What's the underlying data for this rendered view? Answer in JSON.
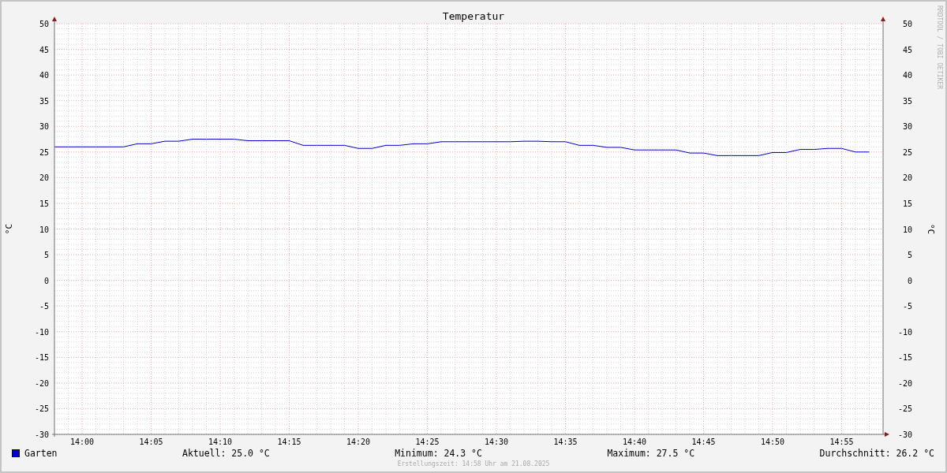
{
  "graph": {
    "watermark": "RRDTOOL / TOBI OETIKER",
    "chart_data": {
      "type": "line",
      "title": "Temperatur",
      "ylabel": "°C",
      "categories": [
        null,
        null,
        "14:00",
        null,
        null,
        null,
        null,
        "14:05",
        null,
        null,
        null,
        null,
        "14:10",
        null,
        null,
        null,
        null,
        "14:15",
        null,
        null,
        null,
        null,
        "14:20",
        null,
        null,
        null,
        null,
        "14:25",
        null,
        null,
        null,
        null,
        "14:30",
        null,
        null,
        null,
        null,
        "14:35",
        null,
        null,
        null,
        null,
        "14:40",
        null,
        null,
        null,
        null,
        "14:45",
        null,
        null,
        null,
        null,
        "14:50",
        null,
        null,
        null,
        null,
        "14:55",
        null,
        null
      ],
      "series": [
        {
          "name": "Garten",
          "color": "#0000cc",
          "values": [
            26.0,
            26.0,
            26.0,
            26.0,
            26.0,
            26.0,
            26.6,
            26.6,
            27.1,
            27.1,
            27.5,
            27.5,
            27.5,
            27.5,
            27.2,
            27.2,
            27.2,
            27.2,
            26.3,
            26.3,
            26.3,
            26.3,
            25.7,
            25.7,
            26.3,
            26.3,
            26.6,
            26.6,
            27.0,
            27.0,
            27.0,
            27.0,
            27.0,
            27.0,
            27.1,
            27.1,
            27.0,
            27.0,
            26.3,
            26.3,
            25.9,
            25.9,
            25.4,
            25.4,
            25.4,
            25.4,
            24.8,
            24.8,
            24.3,
            24.3,
            24.3,
            24.3,
            24.9,
            24.9,
            25.5,
            25.5,
            25.7,
            25.7,
            25.0,
            25.0
          ]
        }
      ],
      "ylim": [
        -30,
        50
      ],
      "grid": true,
      "yticks": [
        50,
        45,
        40,
        35,
        30,
        25,
        20,
        15,
        10,
        5,
        0,
        -5,
        -10,
        -15,
        -20,
        -25,
        -30
      ]
    },
    "right_axis": {
      "label": "°C",
      "ticks": [
        "50",
        "45",
        "40",
        "35",
        "30",
        "25",
        "20",
        "15",
        "10",
        "5",
        "0",
        "-5",
        "-10",
        "-15",
        "-20",
        "-25",
        "-30"
      ]
    }
  },
  "stats": [
    "Aktuell: 25.0 °C",
    "Minimum: 24.3 °C",
    "Maximum: 27.5 °C",
    "Durchschnitt: 26.2 °C"
  ],
  "footer": "Erstellungszeit: 14:58 Uhr am 21.08.2025"
}
